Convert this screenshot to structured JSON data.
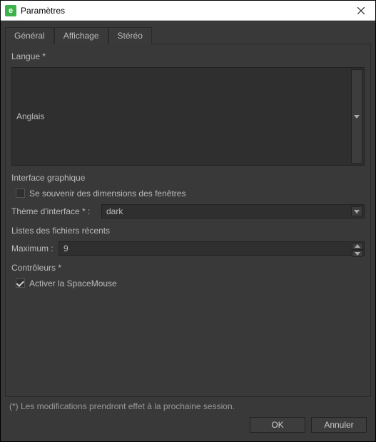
{
  "window": {
    "title": "Paramètres",
    "app_icon_letter": "e"
  },
  "tabs": [
    {
      "label": "Général",
      "active": true
    },
    {
      "label": "Affichage",
      "active": false
    },
    {
      "label": "Stéréo",
      "active": false
    }
  ],
  "general": {
    "language_label": "Langue *",
    "language_value": "Anglais",
    "gui_section_label": "Interface graphique",
    "remember_dims_label": "Se souvenir des dimensions des fenêtres",
    "remember_dims_checked": false,
    "theme_label": "Thème d'interface * :",
    "theme_value": "dark",
    "recent_section_label": "Listes des fichiers récents",
    "max_label": "Maximum :",
    "max_value": "9",
    "controllers_label": "Contrôleurs *",
    "spacemouse_label": "Activer la SpaceMouse",
    "spacemouse_checked": true
  },
  "footer": {
    "note": "(*) Les modifications prendront effet à la prochaine session.",
    "ok_label": "OK",
    "cancel_label": "Annuler"
  }
}
